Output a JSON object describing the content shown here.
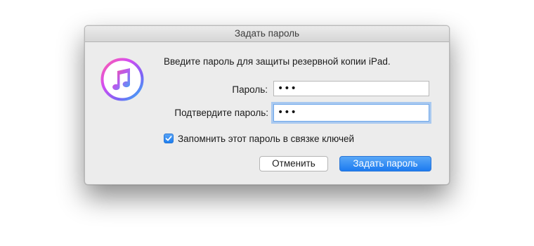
{
  "dialog": {
    "title": "Задать пароль",
    "message": "Введите пароль для защиты резервной копии iPad.",
    "app_icon": "itunes-music-note-icon",
    "password_label": "Пароль:",
    "password_value": "•••",
    "confirm_label": "Подтвердите пароль:",
    "confirm_value": "•••",
    "remember_checked": true,
    "remember_label": "Запомнить этот пароль в связке ключей",
    "cancel_label": "Отменить",
    "ok_label": "Задать пароль",
    "colors": {
      "accent": "#1d7bf0",
      "focus_ring": "#a9c9f0",
      "dialog_bg": "#ececec"
    }
  }
}
